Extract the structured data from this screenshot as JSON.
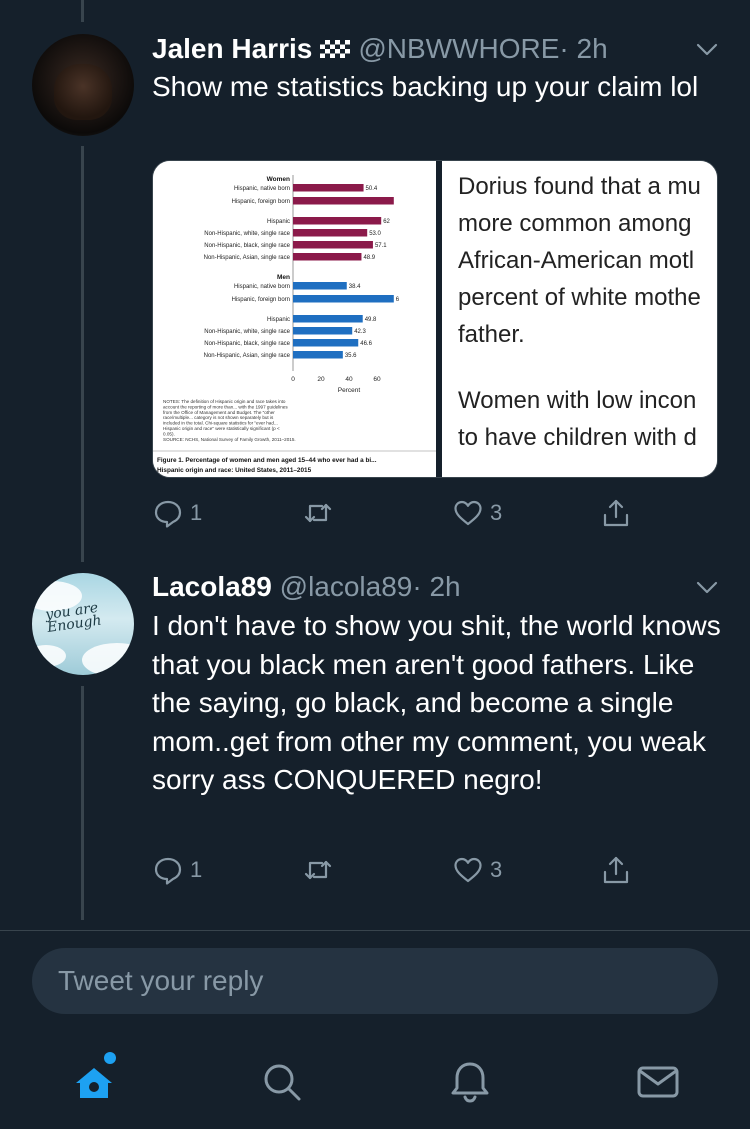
{
  "tweets": [
    {
      "name": "Jalen Harris",
      "handle": "@NBWWHORE",
      "time": "· 2h",
      "text": "Show me statistics backing up your claim lol",
      "replies": "1",
      "retweets": "",
      "likes": "3",
      "flag_icon": "checkered-flag-icon"
    },
    {
      "name": "Lacola89",
      "handle": "@lacola89",
      "time": "· 2h",
      "text": "I don't have to show you shit, the world knows that you black men aren't good fathers. Like the saying, go black, and become a single mom..get from other my comment, you weak sorry ass CONQUERED negro!",
      "replies": "1",
      "retweets": "",
      "likes": "3",
      "avatar_text": "you are Enough"
    }
  ],
  "media": {
    "chart": {
      "women_header": "Women",
      "men_header": "Men",
      "groups_women": [
        {
          "label": "Hispanic, native born",
          "value": 50.4,
          "value_label": "50.4"
        },
        {
          "label": "Hispanic, foreign born",
          "value": 72,
          "value_label": ""
        },
        {
          "label": "Hispanic",
          "value": 63,
          "value_label": "62"
        },
        {
          "label": "Non-Hispanic, white, single race",
          "value": 53.0,
          "value_label": "53.0"
        },
        {
          "label": "Non-Hispanic, black, single race",
          "value": 57.1,
          "value_label": "57.1"
        },
        {
          "label": "Non-Hispanic, Asian, single race",
          "value": 48.9,
          "value_label": "48.9"
        }
      ],
      "groups_men": [
        {
          "label": "Hispanic, native born",
          "value": 38.4,
          "value_label": "38.4"
        },
        {
          "label": "Hispanic, foreign born",
          "value": 72,
          "value_label": "6"
        },
        {
          "label": "Hispanic",
          "value": 49.8,
          "value_label": "49.8"
        },
        {
          "label": "Non-Hispanic, white, single race",
          "value": 42.3,
          "value_label": "42.3"
        },
        {
          "label": "Non-Hispanic, black, single race",
          "value": 46.6,
          "value_label": "46.6"
        },
        {
          "label": "Non-Hispanic, Asian, single race",
          "value": 35.6,
          "value_label": "35.6"
        }
      ],
      "ticks": [
        "0",
        "20",
        "40",
        "60"
      ],
      "xlabel": "Percent",
      "notes": "NOTES: The definition of Hispanic origin and race takes into account the reporting of more than... with the 1997 guidelines from the Office of Management and Budget. The \"other race/multiple... category is not shown separately but is included in the total. Chi-square statistics for \"ever had... Hispanic origin and race\" were statistically significant (p < 0.05).",
      "source": "SOURCE: NCHS, National Survey of Family Growth, 2011–2015.",
      "caption": "Figure 1. Percentage of women and men aged 15–44 who ever had a bi... Hispanic origin and race: United States, 2011–2015",
      "women_color": "#8b1a4a",
      "men_color": "#1f6fc1"
    },
    "article_lines": [
      "Dorius found that a mu",
      "more common among",
      "African-American motl",
      "percent of white mothe",
      "father.",
      "",
      "Women with low incon",
      "to have children with d"
    ]
  },
  "reply_placeholder": "Tweet your reply",
  "tabs": [
    "home-icon",
    "search-icon",
    "notifications-icon",
    "messages-icon"
  ],
  "colors": {
    "background": "#15202b",
    "accent": "#1da1f2",
    "muted": "#8899a6",
    "border": "#38444d"
  }
}
